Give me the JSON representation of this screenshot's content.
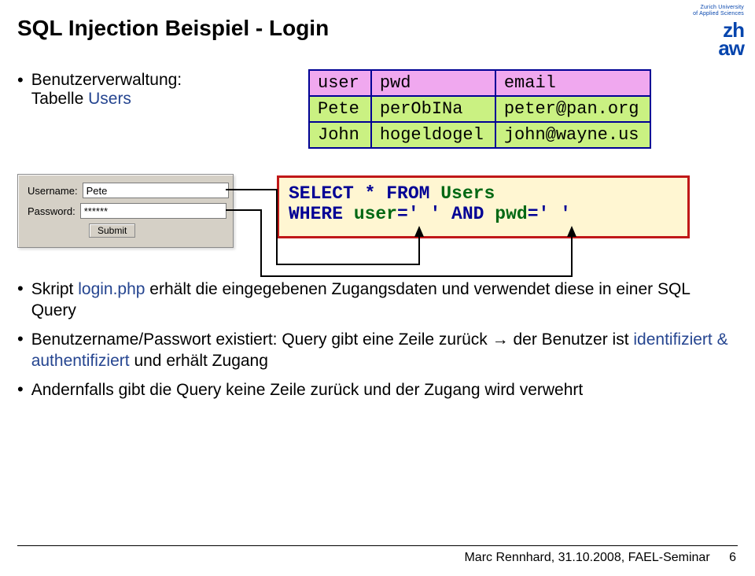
{
  "title": "SQL Injection Beispiel - Login",
  "intro": {
    "line1": "Benutzerverwaltung:",
    "line2_pre": "Tabelle ",
    "line2_em": "Users"
  },
  "table": {
    "header": [
      "user",
      "pwd",
      "email"
    ],
    "rows": [
      [
        "Pete",
        "perObINa",
        "peter@pan.org"
      ],
      [
        "John",
        "hogeldogel",
        "john@wayne.us"
      ]
    ]
  },
  "login": {
    "lbl_user": "Username:",
    "lbl_pwd": "Password:",
    "val_user": "Pete",
    "val_pwd": "******",
    "submit": "Submit"
  },
  "sql": {
    "l1a": "SELECT * FROM ",
    "l1b": "Users",
    "l2a": "WHERE ",
    "l2b": "user",
    "l2c": "='   ' AND ",
    "l2d": "pwd",
    "l2e": "='   '"
  },
  "bullets": {
    "b1_pre": "Skript ",
    "b1_em": "login.php",
    "b1_post": " erhält die eingegebenen Zugangsdaten und verwendet diese in einer SQL Query",
    "b2_pre": "Benutzername/Passwort existiert: Query gibt eine Zeile zurück → der Benutzer ist ",
    "b2_em": "identifiziert & authentifiziert",
    "b2_post": " und erhält Zugang",
    "b3": "Andernfalls gibt die Query keine Zeile zurück und der Zugang wird verwehrt"
  },
  "footer": {
    "text": "Marc Rennhard, 31.10.2008, FAEL-Seminar",
    "page": "6"
  },
  "logo": {
    "uni1": "Zurich University",
    "uni2": "of Applied Sciences",
    "zh": "zh",
    "aw": "aw"
  }
}
